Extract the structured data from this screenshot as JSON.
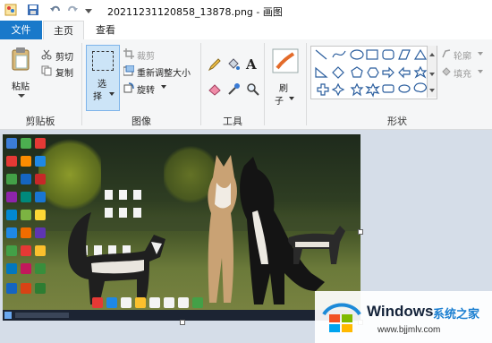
{
  "window": {
    "title": "20211231120858_13878.png - 画图"
  },
  "tabs": {
    "file": "文件",
    "home": "主页",
    "view": "查看"
  },
  "clipboard": {
    "paste": "粘贴",
    "cut": "剪切",
    "copy": "复制",
    "group": "剪贴板"
  },
  "image": {
    "select_1": "选",
    "select_2": "择",
    "crop": "裁剪",
    "resize": "重新调整大小",
    "rotate": "旋转",
    "group": "图像"
  },
  "tools": {
    "group": "工具"
  },
  "brushes": {
    "label_1": "刷",
    "label_2": "子"
  },
  "shapes": {
    "outline": "轮廓",
    "fill": "填充",
    "group": "形状"
  },
  "watermark": {
    "brand": "Windows",
    "cn": "系统之家",
    "url": "www.bjjmlv.com"
  },
  "colors": {
    "file_tab": "#1979ca",
    "ribbon": "#f5f6f7",
    "workspace": "#d5dde8",
    "select_box": "#cce4f7"
  }
}
